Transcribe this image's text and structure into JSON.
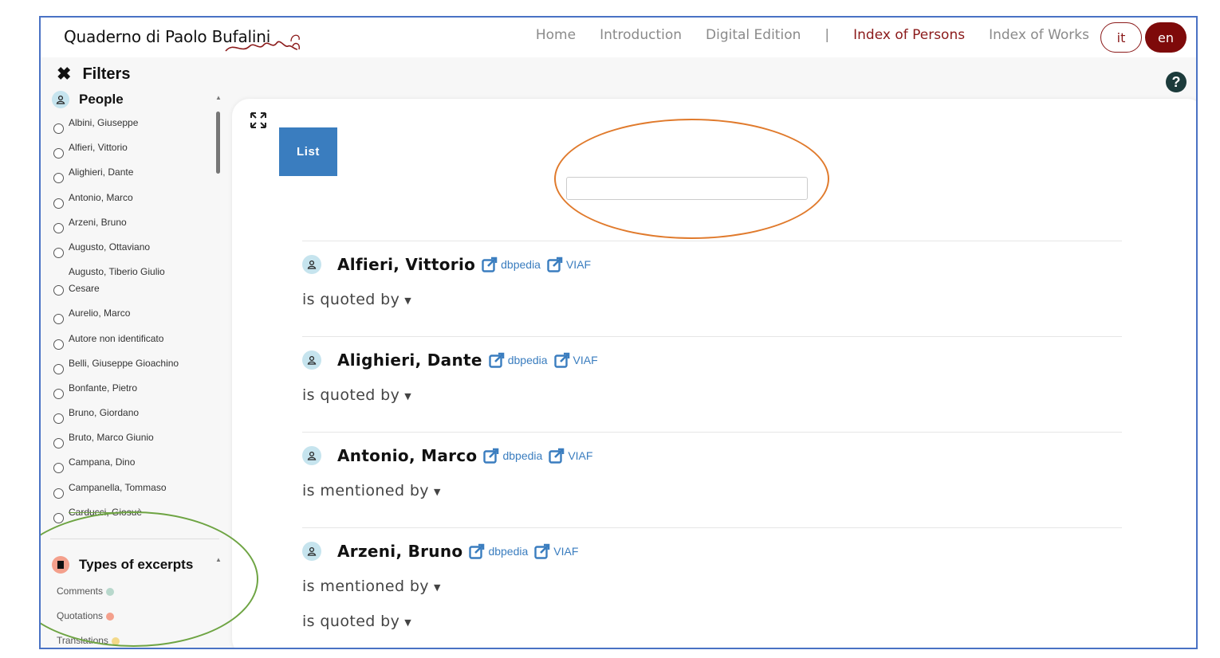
{
  "header": {
    "brand": "Quaderno di Paolo Bufalini",
    "nav": [
      {
        "label": "Home",
        "active": false
      },
      {
        "label": "Introduction",
        "active": false
      },
      {
        "label": "Digital Edition",
        "active": false
      },
      {
        "label": "|",
        "active": false
      },
      {
        "label": "Index of Persons",
        "active": true
      },
      {
        "label": "Index of Works",
        "active": false
      }
    ],
    "lang_it": "it",
    "lang_en": "en"
  },
  "filters": {
    "title": "Filters",
    "close_icon": "close-icon",
    "help": "?"
  },
  "people": {
    "title": "People",
    "items": [
      "Albini, Giuseppe",
      "Alfieri, Vittorio",
      "Alighieri, Dante",
      "Antonio, Marco",
      "Arzeni, Bruno",
      "Augusto, Ottaviano",
      "Augusto, Tiberio Giulio",
      "Cesare",
      "Aurelio, Marco",
      "Autore non identificato",
      "Belli, Giuseppe Gioachino",
      "Bonfante, Pietro",
      "Bruno, Giordano",
      "Bruto, Marco Giunio",
      "Campana, Dino",
      "Campanella, Tommaso",
      "Carducci, Giosuè"
    ]
  },
  "excerpts": {
    "title": "Types of excerpts",
    "items": [
      {
        "label": "Comments",
        "color": "#b8d8cc"
      },
      {
        "label": "Quotations",
        "color": "#f4a08c"
      },
      {
        "label": "Translations",
        "color": "#f3d98a"
      }
    ]
  },
  "main": {
    "list_button": "List",
    "search_value": "",
    "entries": [
      {
        "name": "Alfieri, Vittorio",
        "link1": "dbpedia",
        "link2": "VIAF",
        "relations": [
          "is quoted by"
        ]
      },
      {
        "name": "Alighieri, Dante",
        "link1": "dbpedia",
        "link2": "VIAF",
        "relations": [
          "is quoted by"
        ]
      },
      {
        "name": "Antonio, Marco",
        "link1": "dbpedia",
        "link2": "VIAF",
        "relations": [
          "is mentioned by"
        ]
      },
      {
        "name": "Arzeni, Bruno",
        "link1": "dbpedia",
        "link2": "VIAF",
        "relations": [
          "is mentioned by",
          "is quoted by"
        ]
      }
    ]
  },
  "colors": {
    "accent": "#8b1a1a",
    "button_blue": "#3a7dbf",
    "annotation_orange": "#e07a2c",
    "annotation_green": "#6ea443"
  }
}
